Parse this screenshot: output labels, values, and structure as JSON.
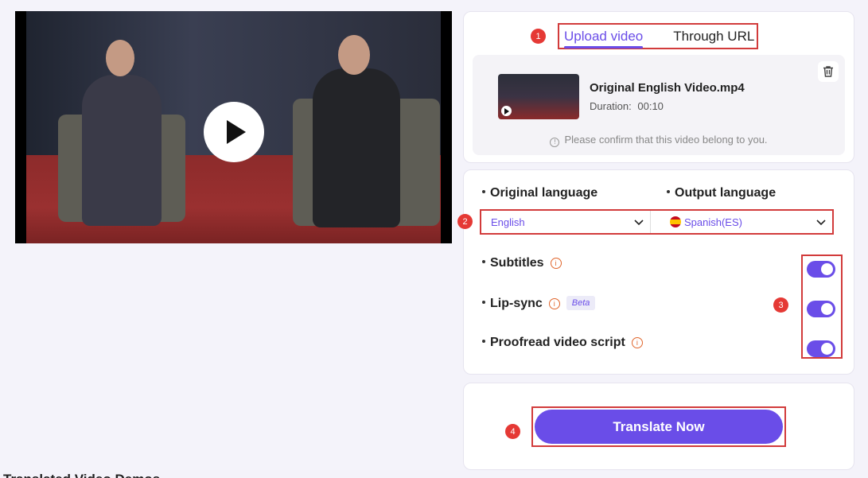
{
  "upload_panel": {
    "marker": "1",
    "tabs": [
      {
        "label": "Upload video",
        "active": true
      },
      {
        "label": "Through URL",
        "active": false
      }
    ],
    "file": {
      "name": "Original English Video.mp4",
      "duration_label": "Duration:",
      "duration": "00:10"
    },
    "notice": "Please confirm that this video belong to you."
  },
  "language_panel": {
    "marker_languages": "2",
    "marker_toggles": "3",
    "original_language_label": "Original language",
    "output_language_label": "Output language",
    "original_language_value": "English",
    "output_language_value": "Spanish(ES)",
    "options": [
      {
        "label": "Subtitles",
        "enabled": true,
        "beta": false
      },
      {
        "label": "Lip-sync",
        "enabled": true,
        "beta": true,
        "beta_label": "Beta"
      },
      {
        "label": "Proofread video script",
        "enabled": true,
        "beta": false
      }
    ]
  },
  "action_panel": {
    "marker": "4",
    "translate_label": "Translate Now"
  },
  "footer": {
    "heading": "Translated Video Demos"
  },
  "colors": {
    "accent": "#6a4de8",
    "marker_red": "#e53935",
    "highlight_border": "#d23b3b"
  },
  "icons": [
    "play-icon",
    "trash-icon",
    "info-icon",
    "chevron-down-icon",
    "spain-flag-icon"
  ]
}
